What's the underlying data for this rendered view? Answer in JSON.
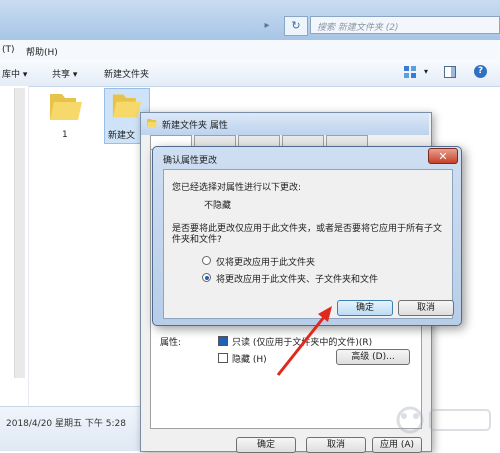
{
  "explorer": {
    "search_placeholder": "搜索 新建文件夹 (2)",
    "menu": [
      "(T)",
      "帮助(H)"
    ],
    "toolbar": {
      "library": "库中 ▾",
      "share": "共享 ▾",
      "new_folder": "新建文件夹"
    },
    "files": [
      {
        "name": "1"
      },
      {
        "name": "新建文"
      }
    ],
    "status": "2018/4/20 星期五 下午 5:28"
  },
  "properties": {
    "title": "新建文件夹 属性",
    "attributes_label": "属性:",
    "readonly_label": "只读 (仅应用于文件夹中的文件)(R)",
    "hidden_label": "隐藏 (H)",
    "advanced_button": "高级 (D)...",
    "ok": "确定",
    "cancel": "取消",
    "apply": "应用 (A)"
  },
  "confirm_dialog": {
    "title": "确认属性更改",
    "line1": "您已经选择对属性进行以下更改:",
    "line2": "不隐藏",
    "question": "是否要将此更改仅应用于此文件夹，或者是否要将它应用于所有子文件夹和文件?",
    "option1": "仅将更改应用于此文件夹",
    "option2": "将更改应用于此文件夹、子文件夹和文件",
    "selected_option": 2,
    "ok": "确定",
    "cancel": "取消"
  },
  "colors": {
    "arrow": "#e0281e",
    "accent": "#1f5fbf"
  }
}
